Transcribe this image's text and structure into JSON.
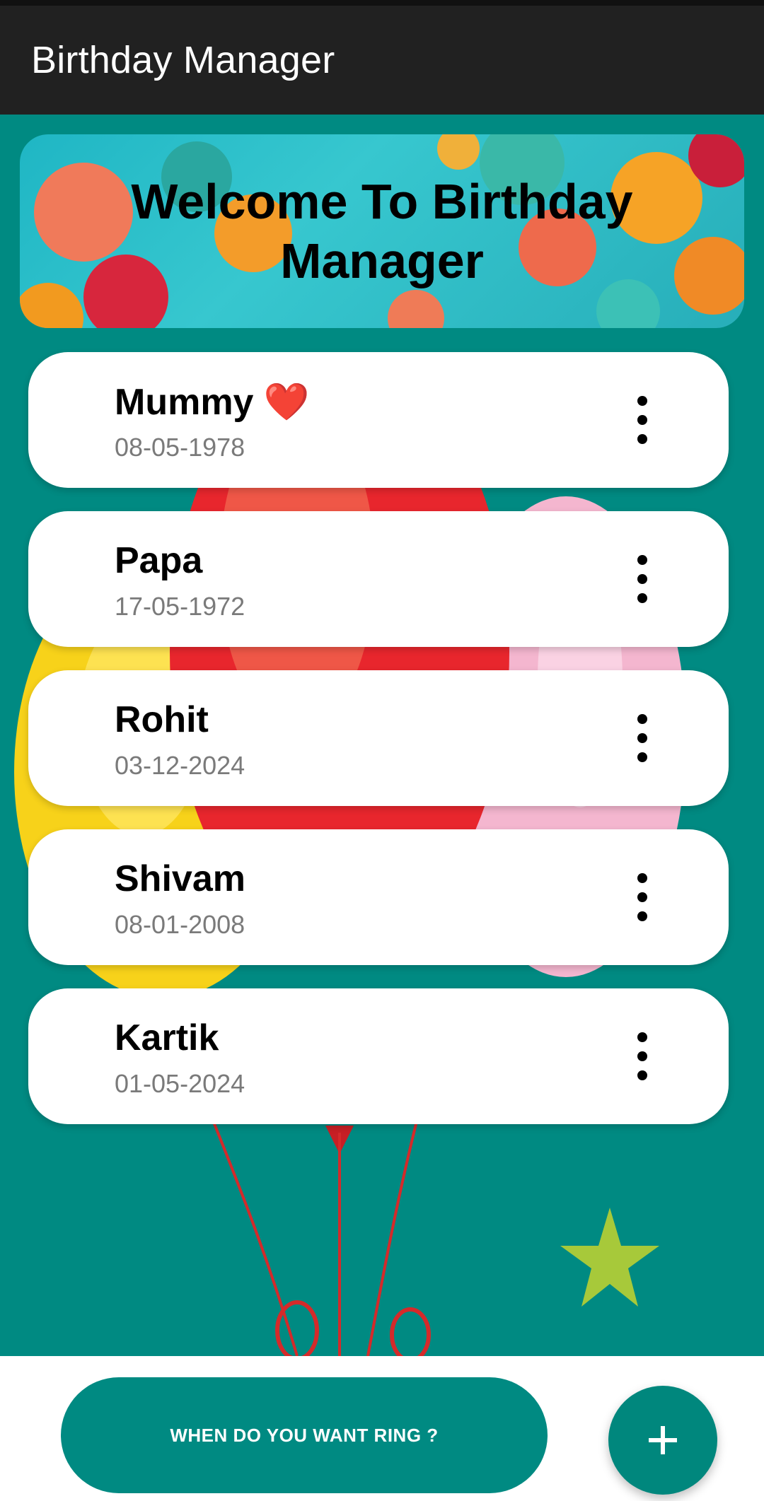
{
  "app_bar": {
    "title": "Birthday Manager"
  },
  "banner": {
    "title": "Welcome To Birthday Manager"
  },
  "birthdays": [
    {
      "name": "Mummy ❤️",
      "date": "08-05-1978"
    },
    {
      "name": "Papa",
      "date": "17-05-1972"
    },
    {
      "name": "Rohit",
      "date": "03-12-2024"
    },
    {
      "name": "Shivam",
      "date": "08-01-2008"
    },
    {
      "name": "Kartik",
      "date": "01-05-2024"
    }
  ],
  "bottom_bar": {
    "ring_button_label": "WHEN DO YOU WANT RING ?",
    "add_button_icon": "plus-icon"
  },
  "colors": {
    "app_bar": "#212121",
    "background": "#008a82",
    "accent": "#00877d",
    "card": "#ffffff"
  }
}
